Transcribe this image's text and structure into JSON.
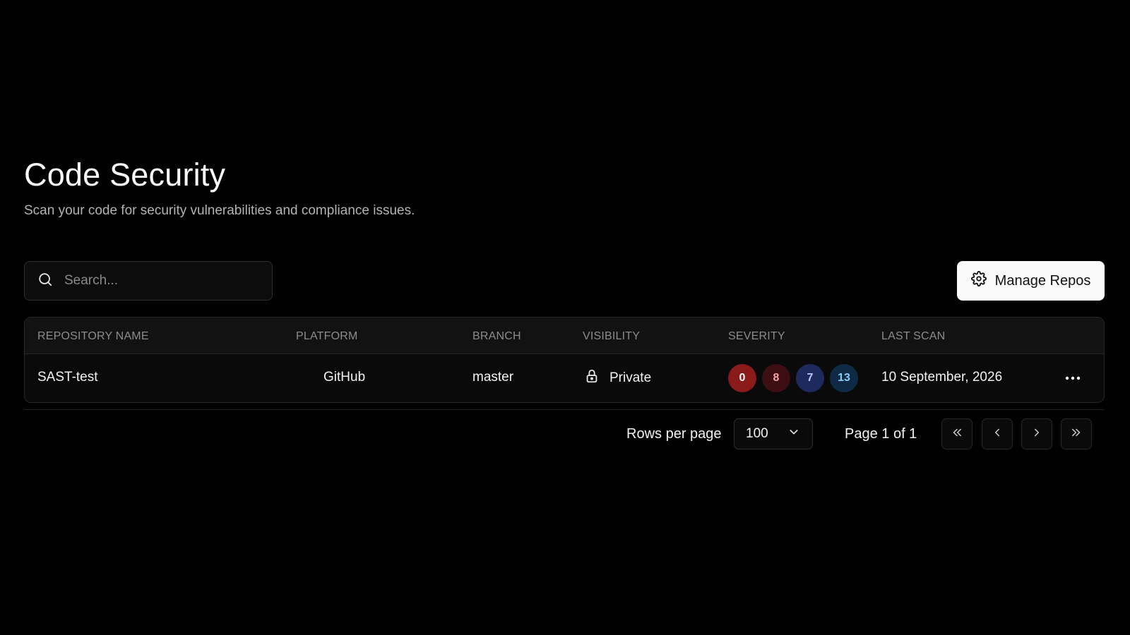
{
  "page": {
    "title": "Code Security",
    "subtitle": "Scan your code for security vulnerabilities and compliance issues."
  },
  "search": {
    "placeholder": "Search...",
    "value": "",
    "icon": "search-icon"
  },
  "toolbar": {
    "manage_label": "Manage Repos",
    "manage_icon": "gear-icon"
  },
  "table": {
    "columns": [
      "REPOSITORY NAME",
      "PLATFORM",
      "BRANCH",
      "VISIBILITY",
      "SEVERITY",
      "LAST SCAN"
    ],
    "rows": [
      {
        "name": "SAST-test",
        "platform": "GitHub",
        "branch": "master",
        "visibility": "Private",
        "visibility_icon": "lock-icon",
        "severity": [
          {
            "count": "0",
            "bg": "#8b1a1a",
            "fg": "#ffffff"
          },
          {
            "count": "8",
            "bg": "#3e0f12",
            "fg": "#f4a6a6"
          },
          {
            "count": "7",
            "bg": "#1e2a5e",
            "fg": "#b7c6ff"
          },
          {
            "count": "13",
            "bg": "#0f2a45",
            "fg": "#8cc8f5"
          }
        ],
        "last_scan": "10 September, 2026",
        "menu_icon": "more-horizontal-icon"
      }
    ]
  },
  "pagination": {
    "rows_per_page_label": "Rows per page",
    "rows_per_page_value": "100",
    "page_info": "Page 1 of 1",
    "buttons": [
      "first-page-icon",
      "previous-page-icon",
      "next-page-icon",
      "last-page-icon"
    ]
  }
}
